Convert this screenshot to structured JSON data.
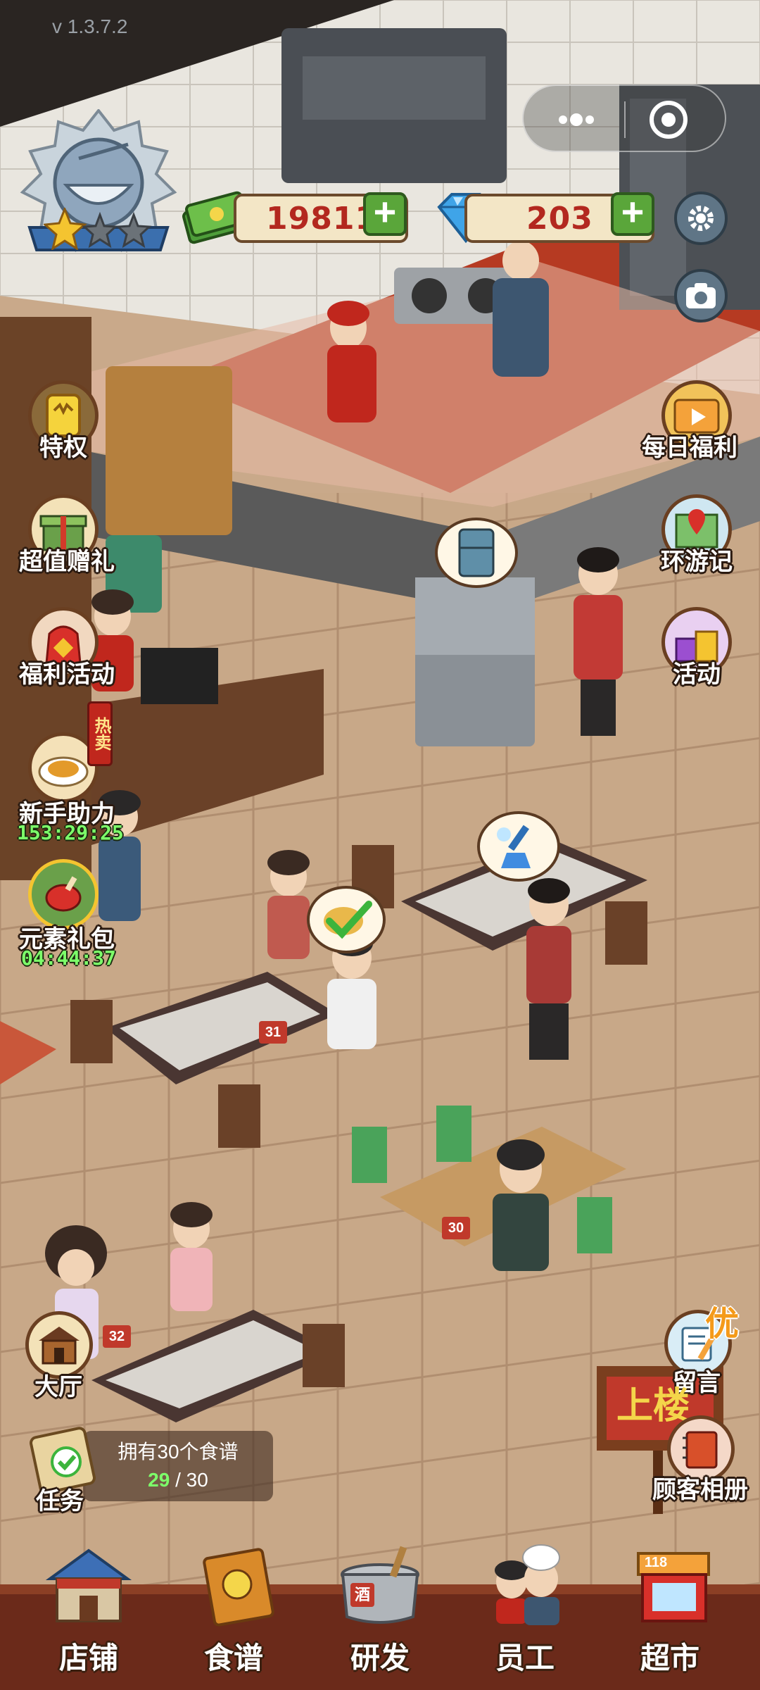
{
  "version": "v 1.3.7.2",
  "resources": {
    "cash": "19811",
    "diamonds": "203"
  },
  "left_menu": [
    {
      "id": "privilege",
      "label": "特权"
    },
    {
      "id": "value_gift",
      "label": "超值赠礼"
    },
    {
      "id": "welfare_event",
      "label": "福利活动"
    },
    {
      "id": "newbie_help",
      "label": "新手助力",
      "timer": "153:29:25",
      "badge": "热卖"
    },
    {
      "id": "element_pack",
      "label": "元素礼包",
      "timer": "04:44:37"
    }
  ],
  "right_menu": [
    {
      "id": "daily_welfare",
      "label": "每日福利"
    },
    {
      "id": "travel_log",
      "label": "环游记"
    },
    {
      "id": "activity",
      "label": "活动"
    }
  ],
  "hall_button": {
    "label": "大厅"
  },
  "task": {
    "label": "任务",
    "title": "拥有30个食谱",
    "progress_current": "29",
    "progress_sep": "/",
    "progress_total": "30"
  },
  "message": {
    "label": "留言",
    "badge": "优"
  },
  "album": {
    "label": "顾客相册"
  },
  "upstairs_sign": "上楼",
  "table_numbers": {
    "t31": "31",
    "t30": "30",
    "t32": "32"
  },
  "supermarket_number": "118",
  "bottom_nav": [
    {
      "id": "shop",
      "label": "店铺"
    },
    {
      "id": "recipes",
      "label": "食谱"
    },
    {
      "id": "research",
      "label": "研发"
    },
    {
      "id": "staff",
      "label": "员工"
    },
    {
      "id": "supermarket",
      "label": "超市"
    }
  ],
  "pot_badge": "酒",
  "rating_stars": 3,
  "rating_filled": 1
}
